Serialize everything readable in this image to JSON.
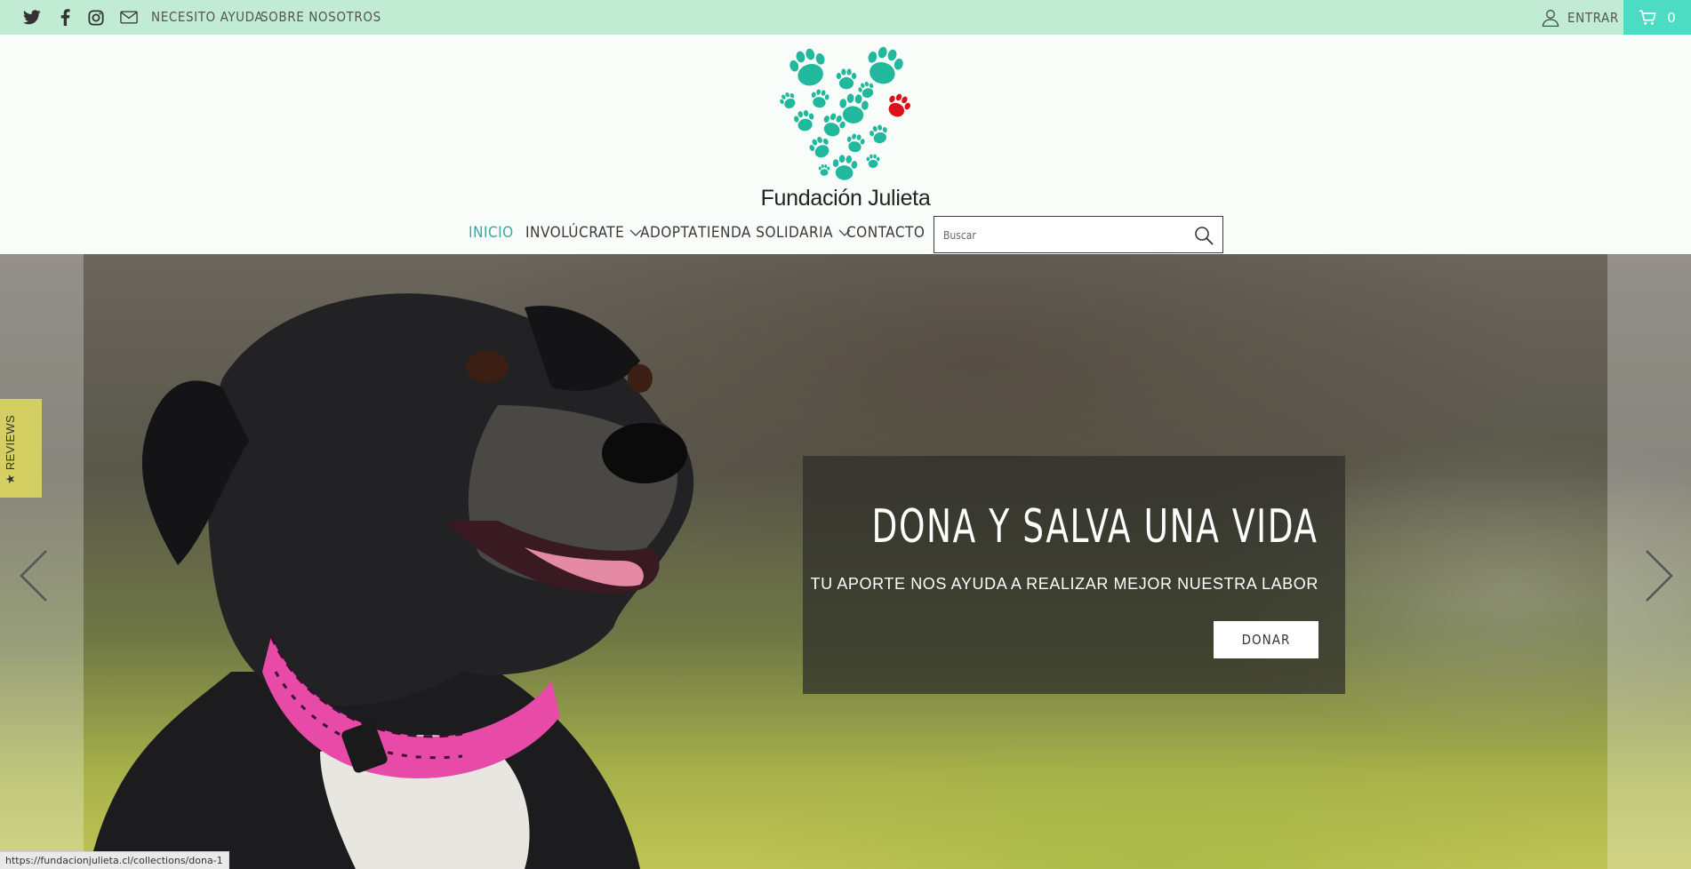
{
  "topbar": {
    "social_icons": [
      "twitter-icon",
      "facebook-icon",
      "instagram-icon",
      "mail-icon"
    ],
    "links": [
      "Necesito ayuda",
      "Sobre Nosotros"
    ],
    "login_label": "Entrar",
    "cart_count": "0",
    "bar_color": "#c1ebd3",
    "cart_color": "#4cdcc3"
  },
  "brand": {
    "name": "Fundación Julieta",
    "logo_colors": {
      "paws": "#22b89d",
      "accent_paw": "#d9121a"
    }
  },
  "nav": {
    "items": [
      {
        "label": "Inicio",
        "active": true
      },
      {
        "label": "Involúcrate",
        "dropdown": true
      },
      {
        "label": "Adopta"
      },
      {
        "label": "Tienda Solidaria",
        "dropdown": true
      },
      {
        "label": "Contacto"
      }
    ]
  },
  "search": {
    "placeholder": "Buscar"
  },
  "hero": {
    "title": "Dona y salva una vida",
    "subtitle": "TU APORTE NOS AYUDA A REALIZAR MEJOR NUESTRA LABOR",
    "button_label": "Donar"
  },
  "reviews_tab": {
    "label": "★ REVIEWS",
    "color": "#d4cf63"
  },
  "status_url": "https://fundacionjulieta.cl/collections/dona-1"
}
